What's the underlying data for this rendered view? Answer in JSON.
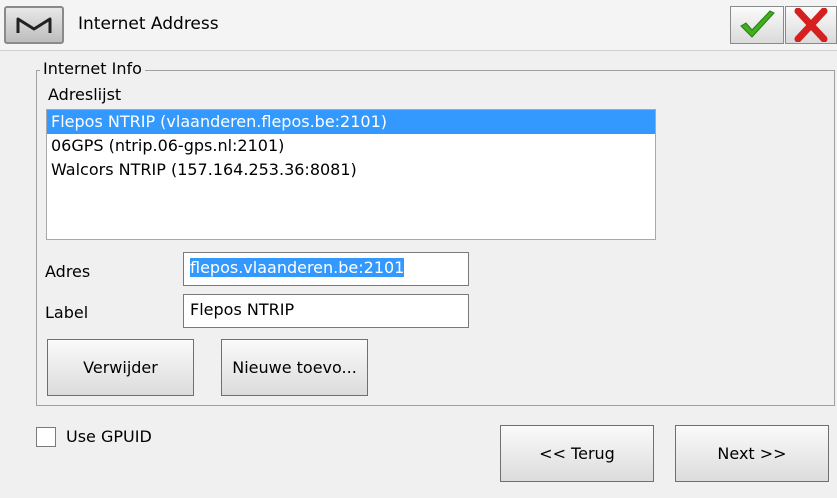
{
  "titlebar": {
    "menu_icon": "m-logo-icon",
    "title": "Internet Address",
    "ok_icon": "checkmark-icon",
    "cancel_icon": "close-icon",
    "ok_color": "#3fae1f",
    "cancel_color": "#d62020"
  },
  "group": {
    "legend": "Internet Info",
    "list_label": "Adreslijst",
    "items": [
      {
        "label": "Flepos NTRIP (vlaanderen.flepos.be:2101)",
        "selected": true
      },
      {
        "label": "06GPS (ntrip.06-gps.nl:2101)",
        "selected": false
      },
      {
        "label": "Walcors NTRIP (157.164.253.36:8081)",
        "selected": false
      }
    ],
    "adres_label": "Adres",
    "adres_value": "flepos.vlaanderen.be:2101",
    "label_label": "Label",
    "label_value": "Flepos NTRIP",
    "remove_button": "Verwijder",
    "new_button": "Nieuwe toevo..."
  },
  "footer": {
    "gpuid_label": "Use GPUID",
    "gpuid_checked": false,
    "back_button": "<< Terug",
    "next_button": "Next >>"
  },
  "colors": {
    "selection": "#3399ff"
  }
}
